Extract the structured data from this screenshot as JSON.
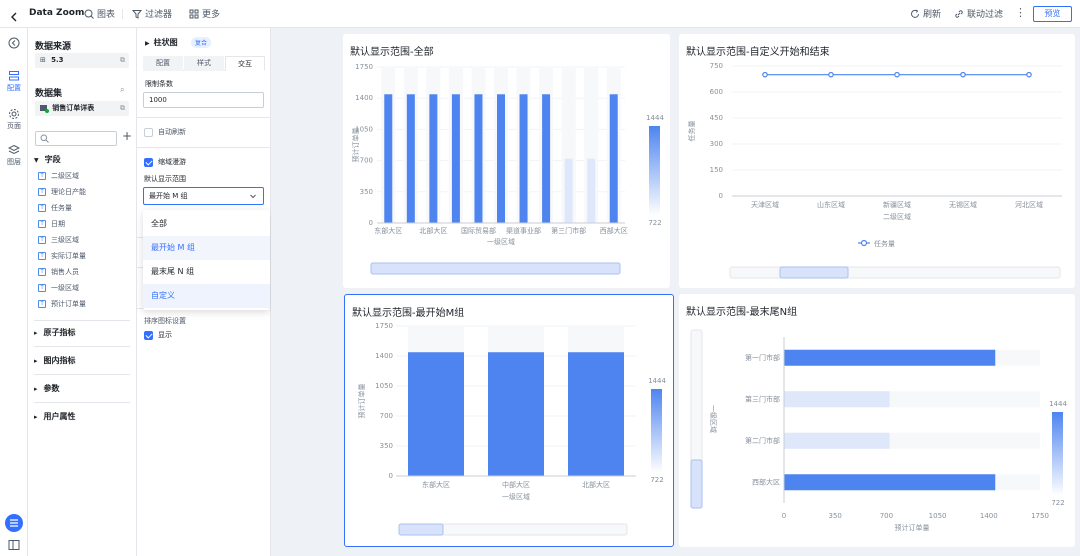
{
  "topbar": {
    "app_title": "Data Zoom",
    "chart_btn": "图表",
    "filter_btn": "过滤器",
    "more_btn": "更多",
    "refresh_btn": "刷新",
    "linkage_btn": "联动过滤",
    "preview_btn": "预览"
  },
  "rail": {
    "config": "配置",
    "page": "页面",
    "layer": "图层"
  },
  "data_panel": {
    "source_title": "数据来源",
    "source_value": "5.3",
    "dataset_title": "数据集",
    "dataset_value": "销售订单详表",
    "search_placeholder": "",
    "fields_title": "字段",
    "fields": [
      "二级区域",
      "理论日产能",
      "任务量",
      "日期",
      "三级区域",
      "实际订单量",
      "销售人员",
      "一级区域",
      "预计订单量"
    ],
    "sections": [
      "原子指标",
      "图内指标",
      "参数",
      "用户属性"
    ]
  },
  "config_panel": {
    "chart_name": "柱状图",
    "chart_tag": "复合",
    "tabs": [
      "配置",
      "样式",
      "交互"
    ],
    "limit_label": "限制条数",
    "limit_value": "1000",
    "auto_refresh": "自动刷新",
    "drill_label": "缩域漫游",
    "range_label": "默认显示范围",
    "range_selected": "最开始 M 组",
    "range_options": [
      "全部",
      "最开始 M 组",
      "最末尾 N 组",
      "自定义"
    ],
    "sort_icon_label": "排序图标设置",
    "show_label": "显示"
  },
  "colors": {
    "accent": "#3370ff",
    "bar": "#4e84f0",
    "bar_light": "#dfe7fb"
  },
  "cards": [
    {
      "title": "默认显示范围-全部"
    },
    {
      "title": "默认显示范围-自定义开始和结束"
    },
    {
      "title": "默认显示范围-最开始M组"
    },
    {
      "title": "默认显示范围-最末尾N组"
    }
  ],
  "chart_data": [
    {
      "type": "bar",
      "title": "默认显示范围-全部",
      "xlabel": "一级区域",
      "ylabel": "预计订单量",
      "ylim": [
        0,
        1750
      ],
      "yticks": [
        0,
        350,
        700,
        1050,
        1400,
        1750
      ],
      "categories": [
        "东部大区",
        "",
        "北部大区",
        "",
        "国际贸易部",
        "",
        "渠道事业部",
        "",
        "第三门市部",
        "",
        "西部大区"
      ],
      "series": [
        {
          "name": "预计订单量",
          "values": [
            1444,
            1444,
            1444,
            1444,
            1444,
            1444,
            1444,
            1444,
            722,
            722,
            1444
          ]
        }
      ],
      "highlight": [
        true,
        true,
        true,
        true,
        true,
        true,
        true,
        true,
        false,
        false,
        true
      ],
      "visual_map": {
        "max": 1444,
        "min": 722
      }
    },
    {
      "type": "line",
      "title": "默认显示范围-自定义开始和结束",
      "xlabel": "二级区域",
      "ylabel": "任务量",
      "ylim": [
        0,
        750
      ],
      "yticks": [
        0,
        150,
        300,
        450,
        600,
        750
      ],
      "categories": [
        "天津区域",
        "山东区域",
        "新疆区域",
        "无锡区域",
        "河北区域"
      ],
      "series": [
        {
          "name": "任务量",
          "values": [
            700,
            700,
            700,
            700,
            700
          ]
        }
      ],
      "legend": [
        "任务量"
      ]
    },
    {
      "type": "bar",
      "title": "默认显示范围-最开始M组",
      "xlabel": "一级区域",
      "ylabel": "预计订单量",
      "ylim": [
        0,
        1750
      ],
      "yticks": [
        0,
        350,
        700,
        1050,
        1400,
        1750
      ],
      "categories": [
        "东部大区",
        "中部大区",
        "北部大区"
      ],
      "series": [
        {
          "name": "预计订单量",
          "values": [
            1444,
            1444,
            1444
          ]
        }
      ],
      "visual_map": {
        "max": 1444,
        "min": 722
      }
    },
    {
      "type": "bar",
      "orientation": "horizontal",
      "title": "默认显示范围-最末尾N组",
      "xlabel": "预计订单量",
      "ylabel": "一级区域",
      "xlim": [
        0,
        1750
      ],
      "xticks": [
        0,
        350,
        700,
        1050,
        1400,
        1750
      ],
      "categories": [
        "第一门市部",
        "第三门市部",
        "第二门市部",
        "西部大区"
      ],
      "series": [
        {
          "name": "预计订单量",
          "values": [
            1444,
            722,
            722,
            1444
          ]
        }
      ],
      "visual_map": {
        "max": 1444,
        "min": 722
      }
    }
  ]
}
